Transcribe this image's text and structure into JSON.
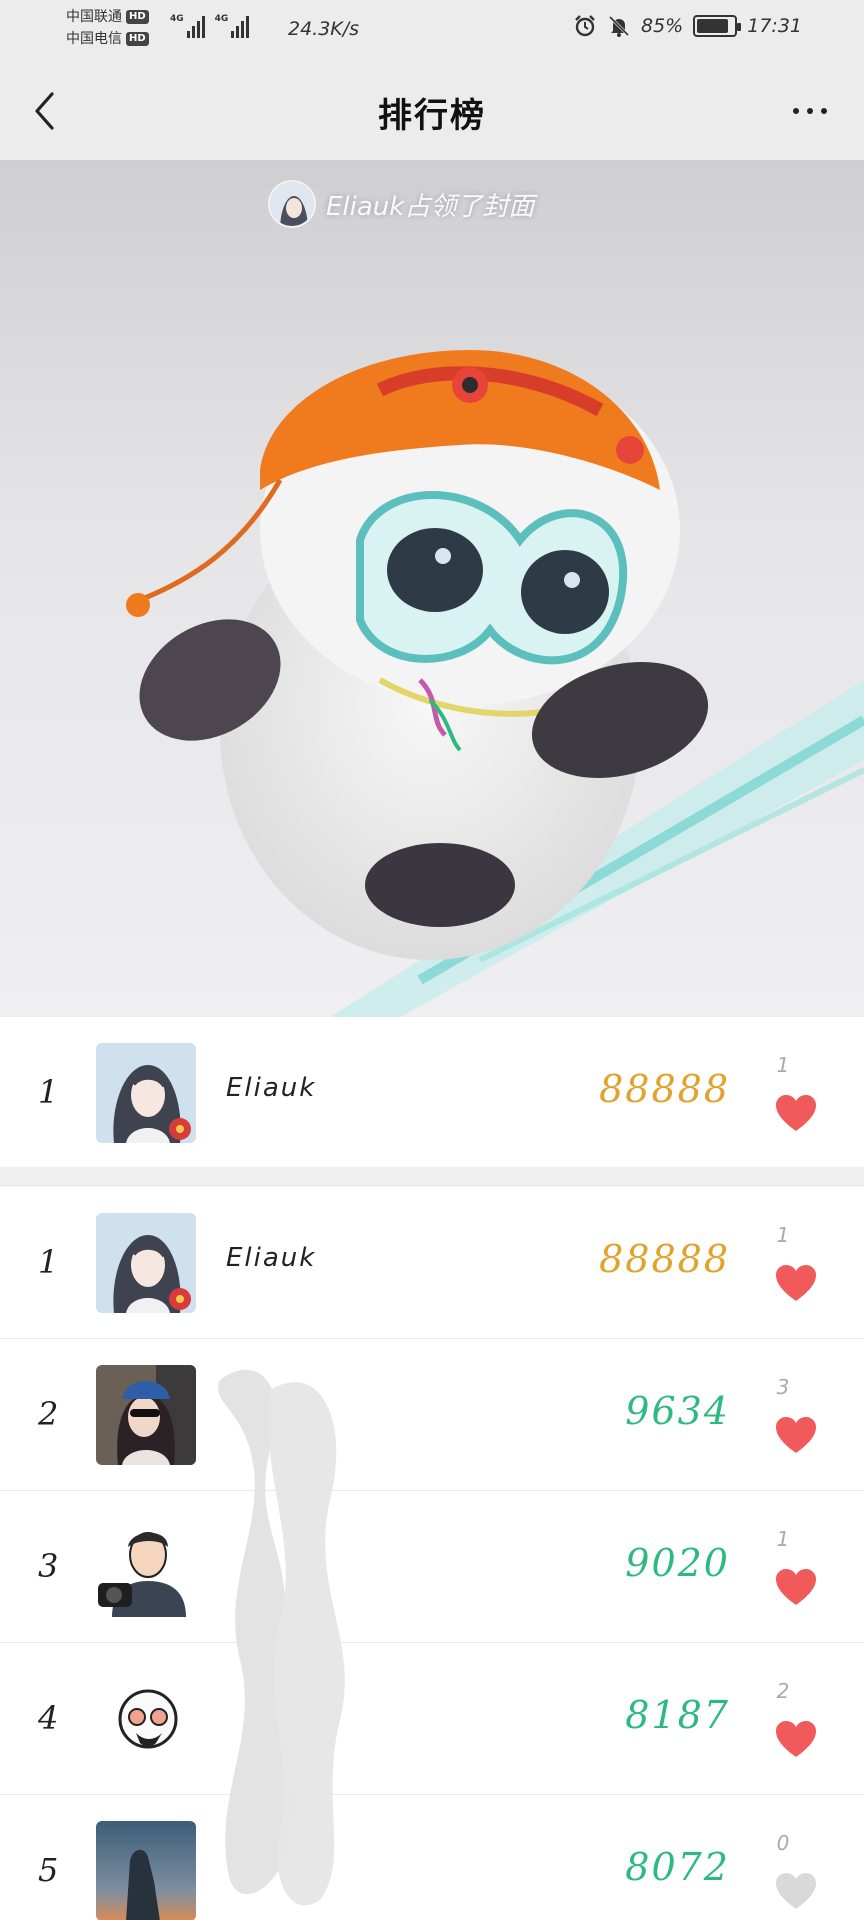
{
  "status_bar": {
    "carrier_1": "中国联通",
    "carrier_2": "中国电信",
    "hd_label": "HD",
    "net_1": "4G",
    "net_2": "4G",
    "speed": "24.3K/s",
    "battery": "85%",
    "battery_level": 0.85,
    "time": "17:31",
    "icons": [
      "alarm-icon",
      "mute-bell-icon",
      "battery-icon"
    ]
  },
  "header": {
    "title": "排行榜",
    "back_icon": "chevron-left-icon",
    "more_icon": "more-dots-icon"
  },
  "cover": {
    "caption": "Eliauk占领了封面"
  },
  "my_rank": {
    "rank": "1",
    "name": "Eliauk",
    "score": "88888",
    "likes": "1",
    "liked": true
  },
  "ranking": [
    {
      "rank": "1",
      "name": "Eliauk",
      "score": "88888",
      "likes": "1",
      "liked": true,
      "color": "#e1a32c"
    },
    {
      "rank": "2",
      "name": "",
      "score": "9634",
      "likes": "3",
      "liked": true,
      "color": "#2db97f"
    },
    {
      "rank": "3",
      "name": "",
      "score": "9020",
      "likes": "1",
      "liked": true,
      "color": "#2db97f"
    },
    {
      "rank": "4",
      "name": "",
      "score": "8187",
      "likes": "2",
      "liked": true,
      "color": "#2db97f"
    },
    {
      "rank": "5",
      "name": "",
      "score": "8072",
      "likes": "0",
      "liked": false,
      "color": "#2db97f"
    }
  ],
  "colors": {
    "heart_active": "#f05a5a",
    "heart_inactive": "#d9d9d9",
    "gold": "#e1a32c",
    "green": "#2db97f"
  }
}
